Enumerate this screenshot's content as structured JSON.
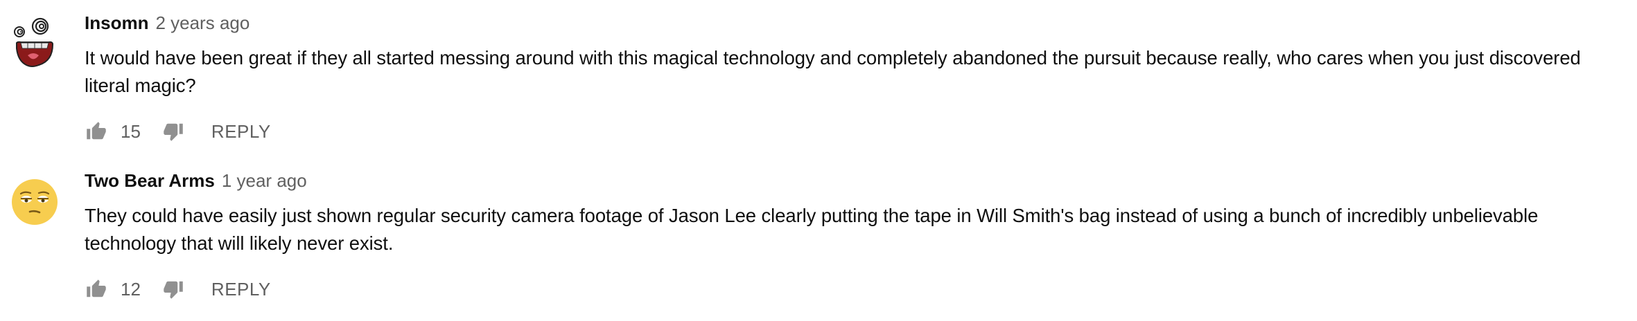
{
  "comments": [
    {
      "author": "Insomn",
      "time": "2 years ago",
      "text": "It would have been great if they all started messing around with this magical technology and completely abandoned the pursuit because really, who cares when you just discovered literal magic?",
      "likes": "15",
      "reply_label": "REPLY",
      "avatar_icon": "dizzy-mouth-face-icon"
    },
    {
      "author": "Two Bear Arms",
      "time": "1 year ago",
      "text": "They could have easily just shown regular security camera footage of Jason Lee clearly putting the tape in Will Smith's bag instead of using a bunch of incredibly unbelievable technology that will likely never exist.",
      "likes": "12",
      "reply_label": "REPLY",
      "avatar_icon": "unamused-face-emoji-icon"
    }
  ],
  "colors": {
    "text": "#0f0f0f",
    "secondary": "#606060",
    "icon": "#909090"
  }
}
